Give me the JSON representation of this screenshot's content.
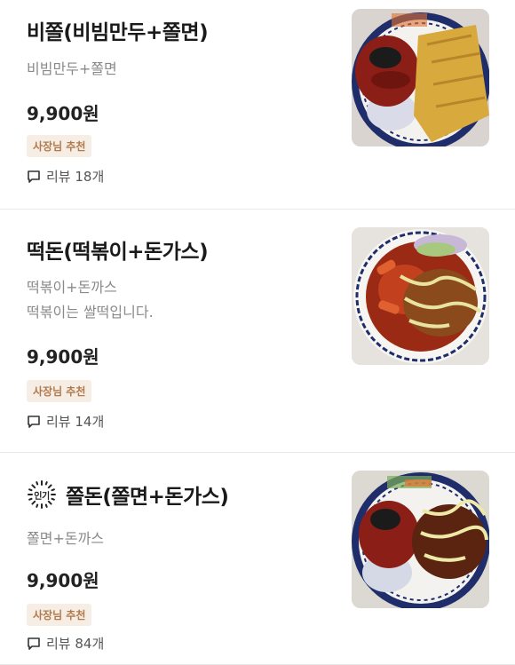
{
  "menu_items": [
    {
      "name": "비쫄(비빔만두+쫄면)",
      "description_lines": [
        "비빔만두+쫄면"
      ],
      "price": "9,900원",
      "badge": "사장님 추천",
      "reviews": "리뷰 18개",
      "image": "bibim-mandu-jjolmyeon-photo"
    },
    {
      "name": "떡돈(떡볶이+돈가스)",
      "description_lines": [
        "떡볶이+돈까스",
        "떡볶이는 쌀떡입니다."
      ],
      "price": "9,900원",
      "badge": "사장님 추천",
      "reviews": "리뷰 14개",
      "image": "tteokbokki-donkatsu-photo"
    },
    {
      "popular_label": "인기",
      "name": "쫄돈(쫄면+돈가스)",
      "description_lines": [
        "쫄면+돈까스"
      ],
      "price": "9,900원",
      "badge": "사장님 추천",
      "reviews": "리뷰 84개",
      "image": "jjolmyeon-donkatsu-photo"
    }
  ],
  "colors": {
    "badge_bg": "#f6ede4",
    "badge_text": "#b07a4c",
    "plate_rim": "#1f2d6b",
    "sauce_red": "#8b1e16",
    "katsu_gold": "#d8a93c"
  }
}
